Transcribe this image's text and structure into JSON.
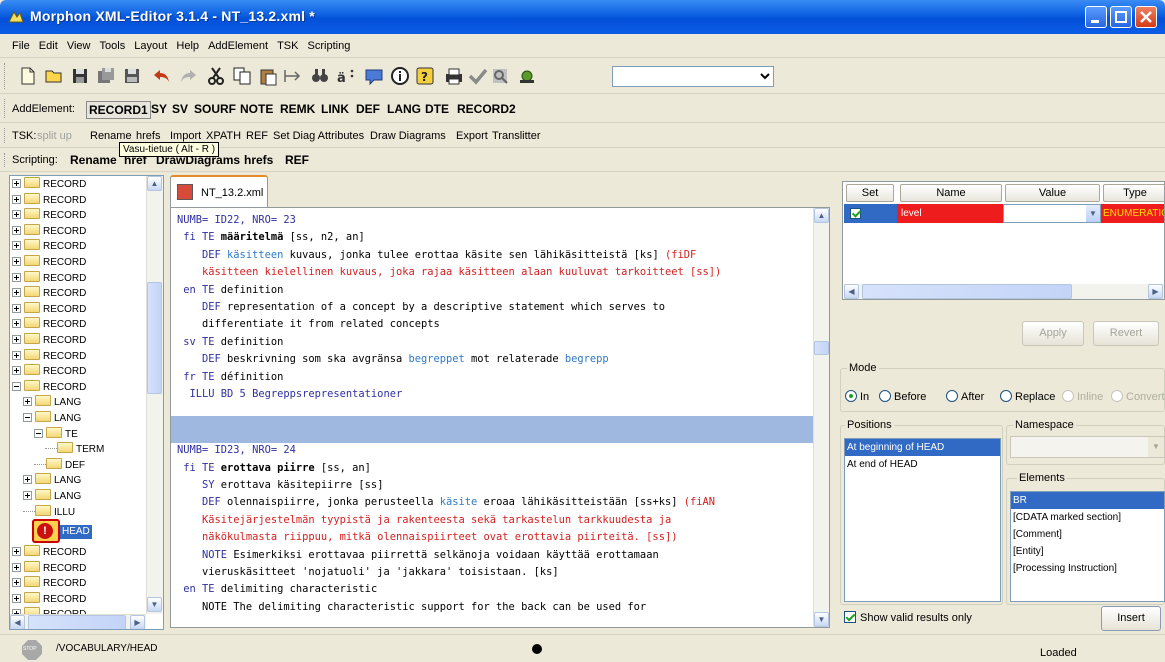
{
  "title": "Morphon XML-Editor 3.1.4 - NT_13.2.xml *",
  "menu": [
    "File",
    "Edit",
    "View",
    "Tools",
    "Layout",
    "Help",
    "AddElement",
    "TSK",
    "Scripting"
  ],
  "toolbar": {
    "icons": [
      "new-file-icon",
      "open-folder-icon",
      "save-icon",
      "save-all-icon",
      "save-as-icon",
      "undo-icon",
      "redo-icon",
      "cut-icon",
      "copy-icon",
      "paste-icon",
      "split-icon",
      "find-icon",
      "replace-icon",
      "validate-icon",
      "info-icon",
      "help-icon",
      "print-icon",
      "check-icon",
      "preview-icon",
      "tree-icon"
    ],
    "combo_value": ""
  },
  "addelement": {
    "label": "AddElement:",
    "items": [
      "RECORD1",
      "SY",
      "SV",
      "SOURF",
      "NOTE",
      "REMK",
      "LINK",
      "DEF",
      "LANG",
      "DTE",
      "RECORD2"
    ]
  },
  "tsk": {
    "label": "TSK:",
    "disabled_item": "split up",
    "items": [
      "Rename",
      "hrefs",
      "Import",
      "XPATH",
      "REF",
      "Set Diag Attributes",
      "Draw Diagrams",
      "Export",
      "Translitter"
    ]
  },
  "tooltip": "Vasu-tietue ( Alt - R )",
  "scripting": {
    "label": "Scripting:",
    "items": [
      "Rename",
      "href",
      "DrawDiagrams",
      "hrefs",
      "REF"
    ]
  },
  "tree": {
    "nodes": [
      {
        "label": "RECORD",
        "indent": 0,
        "expander": "plus"
      },
      {
        "label": "RECORD",
        "indent": 0,
        "expander": "plus"
      },
      {
        "label": "RECORD",
        "indent": 0,
        "expander": "plus"
      },
      {
        "label": "RECORD",
        "indent": 0,
        "expander": "plus"
      },
      {
        "label": "RECORD",
        "indent": 0,
        "expander": "plus"
      },
      {
        "label": "RECORD",
        "indent": 0,
        "expander": "plus"
      },
      {
        "label": "RECORD",
        "indent": 0,
        "expander": "plus"
      },
      {
        "label": "RECORD",
        "indent": 0,
        "expander": "plus"
      },
      {
        "label": "RECORD",
        "indent": 0,
        "expander": "plus"
      },
      {
        "label": "RECORD",
        "indent": 0,
        "expander": "plus"
      },
      {
        "label": "RECORD",
        "indent": 0,
        "expander": "plus"
      },
      {
        "label": "RECORD",
        "indent": 0,
        "expander": "plus"
      },
      {
        "label": "RECORD",
        "indent": 0,
        "expander": "plus"
      },
      {
        "label": "RECORD",
        "indent": 0,
        "expander": "minus"
      },
      {
        "label": "LANG",
        "indent": 1,
        "expander": "plus"
      },
      {
        "label": "LANG",
        "indent": 1,
        "expander": "minus"
      },
      {
        "label": "TE",
        "indent": 2,
        "expander": "minus"
      },
      {
        "label": "TERM",
        "indent": 3,
        "expander": "none"
      },
      {
        "label": "DEF",
        "indent": 2,
        "expander": "none"
      },
      {
        "label": "LANG",
        "indent": 1,
        "expander": "plus"
      },
      {
        "label": "LANG",
        "indent": 1,
        "expander": "plus"
      },
      {
        "label": "ILLU",
        "indent": 1,
        "expander": "none"
      }
    ],
    "head_label": "HEAD",
    "after": [
      "RECORD",
      "RECORD",
      "RECORD",
      "RECORD",
      "RECORD"
    ]
  },
  "editor": {
    "tab": "NT_13.2.xml",
    "lines": [
      [
        {
          "t": "NUMB= ID22, NRO= 23",
          "c": "kw"
        }
      ],
      [
        {
          "t": " fi ",
          "c": "kw"
        },
        {
          "t": "TE",
          "c": "kw"
        },
        {
          "t": " määritelmä",
          "c": "bl"
        },
        {
          "t": " [ss, n2, an]",
          "c": ""
        }
      ],
      [
        {
          "t": "    DEF ",
          "c": "kw"
        },
        {
          "t": "käsitteen",
          "c": "fbl"
        },
        {
          "t": " kuvaus, jonka tulee erottaa käsite sen lähikäsitteistä [ks] ",
          "c": ""
        },
        {
          "t": "(fiDF",
          "c": "rd"
        }
      ],
      [
        {
          "t": "    käsitteen kielellinen kuvaus, joka rajaa käsitteen alaan kuuluvat tarkoitteet [ss])",
          "c": "rd"
        }
      ],
      [
        {
          "t": " en ",
          "c": "kw"
        },
        {
          "t": "TE",
          "c": "kw"
        },
        {
          "t": " definition",
          "c": ""
        }
      ],
      [
        {
          "t": "    DEF ",
          "c": "kw"
        },
        {
          "t": "representation of a concept by a descriptive statement which serves to",
          "c": ""
        }
      ],
      [
        {
          "t": "    differentiate it from related concepts",
          "c": ""
        }
      ],
      [
        {
          "t": " sv ",
          "c": "kw"
        },
        {
          "t": "TE",
          "c": "kw"
        },
        {
          "t": " definition",
          "c": ""
        }
      ],
      [
        {
          "t": "    DEF ",
          "c": "kw"
        },
        {
          "t": "beskrivning som ska avgränsa ",
          "c": ""
        },
        {
          "t": "begreppet",
          "c": "fbl"
        },
        {
          "t": " mot relaterade ",
          "c": ""
        },
        {
          "t": "begrepp",
          "c": "fbl"
        }
      ],
      [
        {
          "t": " fr ",
          "c": "kw"
        },
        {
          "t": "TE",
          "c": "kw"
        },
        {
          "t": " définition",
          "c": ""
        }
      ],
      [
        {
          "t": "  ILLU BD 5 Begreppsrepresentationer",
          "c": "kw"
        }
      ],
      [
        {
          "t": "",
          "c": ""
        }
      ],
      [
        {
          "t": "",
          "c": ""
        }
      ],
      [
        {
          "t": "NUMB= ID23, NRO= 24",
          "c": "kw"
        }
      ],
      [
        {
          "t": " fi ",
          "c": "kw"
        },
        {
          "t": "TE",
          "c": "kw"
        },
        {
          "t": " erottava piirre",
          "c": "bl"
        },
        {
          "t": " [ss, an]",
          "c": ""
        }
      ],
      [
        {
          "t": "    SY ",
          "c": "kw"
        },
        {
          "t": "erottava käsitepiirre [ss]",
          "c": ""
        }
      ],
      [
        {
          "t": "    DEF ",
          "c": "kw"
        },
        {
          "t": "olennaispiirre, jonka perusteella ",
          "c": ""
        },
        {
          "t": "käsite",
          "c": "fbl"
        },
        {
          "t": " eroaa lähikäsitteistään [ss+ks] ",
          "c": ""
        },
        {
          "t": "(fiAN",
          "c": "rd"
        }
      ],
      [
        {
          "t": "    Käsitejärjestelmän tyypistä ja rakenteesta sekä tarkastelun tarkkuudesta ja",
          "c": "rd"
        }
      ],
      [
        {
          "t": "    näkökulmasta riippuu, mitkä olennaispiirteet ovat erottavia piirteitä. [ss])",
          "c": "rd"
        }
      ],
      [
        {
          "t": "    NOTE ",
          "c": "kw"
        },
        {
          "t": "Esimerkiksi erottavaa piirrettä selkänoja voidaan käyttää erottamaan",
          "c": ""
        }
      ],
      [
        {
          "t": "    vieruskäsitteet 'nojatuoli' ja 'jakkara' toisistaan. [ks]",
          "c": ""
        }
      ],
      [
        {
          "t": " en ",
          "c": "kw"
        },
        {
          "t": "TE",
          "c": "kw"
        },
        {
          "t": " delimiting characteristic",
          "c": ""
        }
      ],
      [
        {
          "t": "    NOTE The delimiting characteristic support for the back can be used for",
          "c": ""
        }
      ]
    ]
  },
  "attributes": {
    "headers": [
      "Set",
      "Name",
      "Value",
      "Type"
    ],
    "rows": [
      {
        "set": true,
        "name": "level",
        "value": "",
        "type": "ENUMERATIC"
      }
    ],
    "apply": "Apply",
    "revert": "Revert"
  },
  "mode": {
    "label": "Mode",
    "options": [
      {
        "label": "In",
        "selected": true,
        "enabled": true
      },
      {
        "label": "Before",
        "selected": false,
        "enabled": true
      },
      {
        "label": "After",
        "selected": false,
        "enabled": true
      },
      {
        "label": "Replace",
        "selected": false,
        "enabled": true
      },
      {
        "label": "Inline",
        "selected": false,
        "enabled": false
      },
      {
        "label": "Convert",
        "selected": false,
        "enabled": false
      }
    ]
  },
  "positions": {
    "label": "Positions",
    "items": [
      "At beginning of HEAD",
      "At end of HEAD"
    ],
    "selected": 0
  },
  "namespace": {
    "label": "Namespace",
    "value": ""
  },
  "elements": {
    "label": "Elements",
    "items": [
      "BR",
      "[CDATA marked section]",
      "[Comment]",
      "[Entity]",
      "[Processing Instruction]"
    ],
    "selected": 0
  },
  "show_valid": {
    "label": "Show valid results only",
    "checked": true
  },
  "insert": "Insert",
  "status": {
    "path": "/VOCABULARY/HEAD",
    "state": "Loaded"
  },
  "colors": {
    "titlebar": "#0a5fe0",
    "selection": "#316ac5",
    "error_row": "#ee1c1c",
    "keyword": "#2f2fa0",
    "note_red": "#d41f1f",
    "term_blue": "#2f7ac8"
  }
}
